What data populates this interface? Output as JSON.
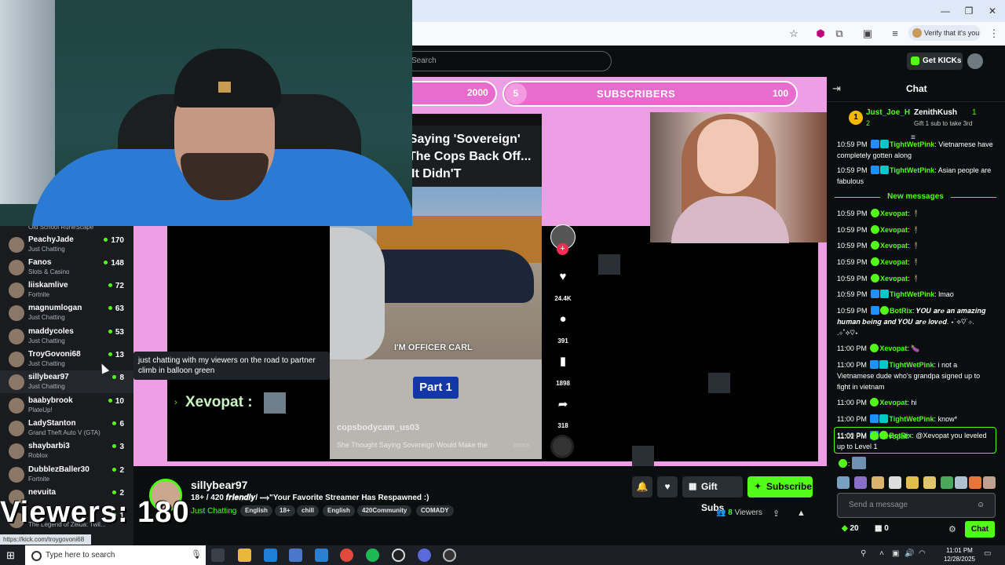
{
  "browser": {
    "verify_label": "Verify that it's you"
  },
  "kick": {
    "search_placeholder": "Search",
    "get_kicks_label": "Get KICKs"
  },
  "sidebar": {
    "partial_category": "Old School RuneScape",
    "items": [
      {
        "name": "PeachyJade",
        "category": "Just Chatting",
        "count": "170"
      },
      {
        "name": "Fanos",
        "category": "Slots & Casino",
        "count": "148"
      },
      {
        "name": "liiskamlive",
        "category": "Fortnite",
        "count": "72"
      },
      {
        "name": "magnumlogan",
        "category": "Just Chatting",
        "count": "63"
      },
      {
        "name": "maddycoles",
        "category": "Just Chatting",
        "count": "53"
      },
      {
        "name": "TroyGovoni68",
        "category": "Just Chatting",
        "count": "13"
      },
      {
        "name": "sillybear97",
        "category": "Just Chatting",
        "count": "8"
      },
      {
        "name": "baabybrook",
        "category": "PlateUp!",
        "count": "10"
      },
      {
        "name": "LadyStanton",
        "category": "Grand Theft Auto V (GTA)",
        "count": "6"
      },
      {
        "name": "shaybarbi3",
        "category": "Roblox",
        "count": "3"
      },
      {
        "name": "DubblezBaller30",
        "category": "Fortnite",
        "count": "2"
      },
      {
        "name": "nevuita",
        "category": "",
        "count": "2"
      },
      {
        "name": "",
        "category": "The Legend of Zelda: Twil...",
        "count": "1"
      }
    ],
    "tooltip": "just chatting with my viewers on the road to partner climb in balloon green"
  },
  "overlay": {
    "sub_goal_left": "2000",
    "sub_current": "5",
    "sub_label": "SUBSCRIBERS",
    "sub_goal": "100",
    "viewers_big": "Viewers: 180",
    "chat_name": "Xevopat :"
  },
  "tiktok": {
    "headline": [
      "t Saying 'Sovereign'",
      "The Cops Back Off...",
      "It Didn'T"
    ],
    "caption": "I'M OFFICER CARL",
    "part": "Part 1",
    "user": "copsbodycam_us03",
    "desc": "She Thought Saying Sovereign Would Make the",
    "more": "more",
    "likes": "24.4K",
    "comments": "391",
    "saves": "1898",
    "shares": "318"
  },
  "stream": {
    "channel": "sillybear97",
    "title": "18+ / 420 𝒇𝒓𝒊𝒆𝒏𝒅𝒍𝒚/ ⟶\"Your Favorite Streamer Has Respawned :)",
    "category": "Just Chatting",
    "tags": [
      "English",
      "18+",
      "chill",
      "English",
      "420Community",
      "COMADY"
    ],
    "gift_label": "Gift Subs",
    "subscribe_label": "Subscribe",
    "viewers_count": "8",
    "viewers_label": "Viewers"
  },
  "status_url": "https://kick.com/troygovoni68",
  "chat": {
    "title": "Chat",
    "pinned": {
      "rank": "1",
      "user1": "Just_Joe_H",
      "count1": "2",
      "user2": "ZenithKush",
      "count2": "1",
      "desc2": "Gift 1 sub to take 3rd"
    },
    "messages": [
      {
        "time": "10:59 PM",
        "user": "TightWetPink",
        "text": "Vietnamese have completely gotten along"
      },
      {
        "time": "10:59 PM",
        "user": "TightWetPink",
        "text": "Asian people are fabulous"
      },
      {
        "time": "10:59 PM",
        "user": "Xevopat",
        "text": "🕴"
      },
      {
        "time": "10:59 PM",
        "user": "Xevopat",
        "text": "🕴"
      },
      {
        "time": "10:59 PM",
        "user": "Xevopat",
        "text": "🕴"
      },
      {
        "time": "10:59 PM",
        "user": "Xevopat",
        "text": "🕴"
      },
      {
        "time": "10:59 PM",
        "user": "Xevopat",
        "text": "🕴"
      },
      {
        "time": "10:59 PM",
        "user": "TightWetPink",
        "text": "lmao"
      },
      {
        "time": "10:59 PM",
        "user": "BotRix",
        "text": "𝒀𝑶𝑼 𝒂𝒓𝒆 𝒂𝒏 𝒂𝒎𝒂𝒛𝒊𝒏𝒈 𝒉𝒖𝒎𝒂𝒏 𝒃𝒆𝒊𝒏𝒈 𝒂𝒏𝒅 𝒀𝑶𝑼 𝒂𝒓𝒆 𝒍𝒐𝒗𝒆𝒅. ⋆˙⟡♡˙⊹. .⊹˚⟡♡⋆"
      },
      {
        "time": "11:00 PM",
        "user": "Xevopat",
        "text": "🍆"
      },
      {
        "time": "11:00 PM",
        "user": "TightWetPink",
        "text": "i not a Vietnamese dude who's grandpa signed up to fight in vietnam"
      },
      {
        "time": "11:00 PM",
        "user": "Xevopat",
        "text": "hi"
      },
      {
        "time": "11:00 PM",
        "user": "TightWetPink",
        "text": "know*"
      },
      {
        "time": "11:00 PM",
        "user": "BotRix",
        "text": "@Xevopat you leveled up to Level 1"
      },
      {
        "time": "11:01 PM",
        "user": "Xevopat",
        "text": ""
      }
    ],
    "new_messages": "New messages",
    "input_placeholder": "Send a message",
    "kicks": "20",
    "gifts": "0",
    "chat_button": "Chat"
  },
  "taskbar": {
    "search_placeholder": "Type here to search",
    "time": "11:01 PM",
    "date": "12/28/2025"
  }
}
